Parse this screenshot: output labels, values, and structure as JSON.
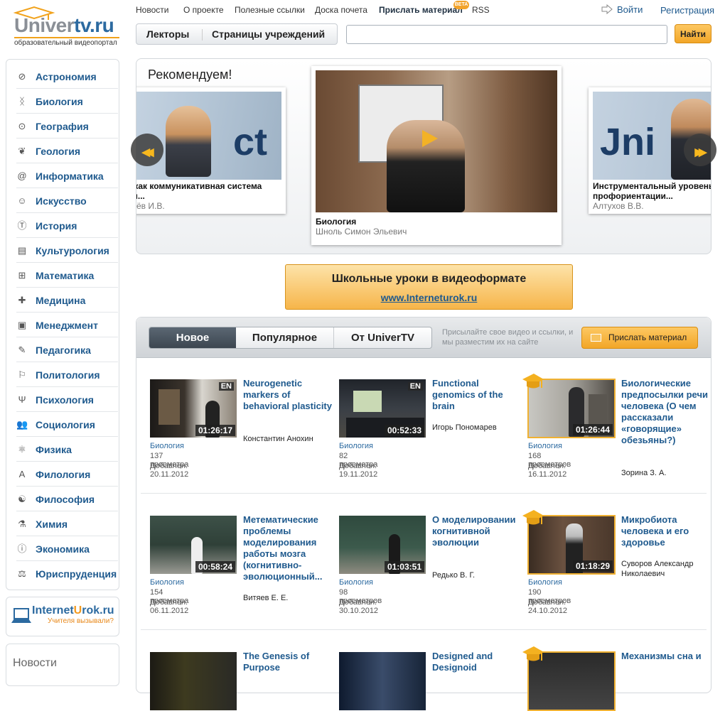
{
  "logo": {
    "name_a": "Univer",
    "name_b": "tv.ru",
    "slogan": "образовательный видеопортал"
  },
  "topnav": [
    "Новости",
    "О проекте",
    "Полезные ссылки",
    "Доска почета",
    "Прислать материал",
    "RSS"
  ],
  "beta": "BETA",
  "auth": {
    "login": "Войти",
    "register": "Регистрация"
  },
  "seg": {
    "lecturers": "Лекторы",
    "institutions": "Страницы учреждений"
  },
  "search": {
    "value": "",
    "button": "Найти"
  },
  "categories": [
    "Астрономия",
    "Биология",
    "География",
    "Геология",
    "Информатика",
    "Искусство",
    "История",
    "Культурология",
    "Математика",
    "Медицина",
    "Менеджмент",
    "Педагогика",
    "Политология",
    "Психология",
    "Социология",
    "Физика",
    "Филология",
    "Философия",
    "Химия",
    "Экономика",
    "Юриспруденция"
  ],
  "internet_urok": {
    "a": "Internet",
    "b": "U",
    "c": "rok.ru",
    "slogan": "Учителя вызывали?"
  },
  "news_title": "Новости",
  "carousel": {
    "title": "Рекомендуем!",
    "left": {
      "title": "я как коммуникативная система",
      "title2": "мя...",
      "author": "ллёв И.В."
    },
    "center": {
      "category": "Биология",
      "author": "Шноль Симон Эльевич"
    },
    "right": {
      "title": "Инструментальный уровень",
      "title2": "профориентации...",
      "author": "Алтухов В.В."
    }
  },
  "banner": {
    "title": "Школьные уроки в видеоформате",
    "link": "www.Interneturok.ru"
  },
  "tabs": [
    "Новое",
    "Популярное",
    "От UniverTV"
  ],
  "hint": "Присылайте свое видео и ссылки, и мы разместим их на сайте",
  "send_button": "Прислать материал",
  "videos": [
    {
      "title": "Neurogenetic markers of behavioral plasticity",
      "author": "Константин Анохин",
      "duration": "01:26:17",
      "en": "EN",
      "category": "Биология",
      "views": "137 просмотра",
      "added": "Добавлен: 20.11.2012"
    },
    {
      "title": "Functional genomics of the brain",
      "author": "Игорь Пономарев",
      "duration": "00:52:33",
      "en": "EN",
      "category": "Биология",
      "views": "82 просмотра",
      "added": "Добавлен: 19.11.2012"
    },
    {
      "title": "Биологические предпосылки речи человека (О чем рассказали «говорящие» обезьяны?)",
      "author": "Зорина З. А.",
      "duration": "01:26:44",
      "category": "Биология",
      "views": "168 просмотров",
      "added": "Добавлен: 16.11.2012"
    },
    {
      "title": "Метематические проблемы моделирования работы мозга (когнитивно-эволюционный...",
      "author": "Витяев Е. Е.",
      "duration": "00:58:24",
      "category": "Биология",
      "views": "154 просмотра",
      "added": "Добавлен: 06.11.2012"
    },
    {
      "title": "О моделировании когнитивной эволюции",
      "author": "Редько В. Г.",
      "duration": "01:03:51",
      "category": "Биология",
      "views": "98 просмотров",
      "added": "Добавлен: 30.10.2012"
    },
    {
      "title": "Микробиота человека и его здоровье",
      "author": "Суворов Александр Николаевич",
      "duration": "01:18:29",
      "category": "Биология",
      "views": "190 просмотров",
      "added": "Добавлен: 24.10.2012"
    },
    {
      "title": "The Genesis of Purpose"
    },
    {
      "title": "Designed and Designoid"
    },
    {
      "title": "Механизмы сна и"
    }
  ],
  "colors": {
    "accent": "#f2a628",
    "link": "#1f5a8e",
    "tab_active": "#4a5560"
  }
}
